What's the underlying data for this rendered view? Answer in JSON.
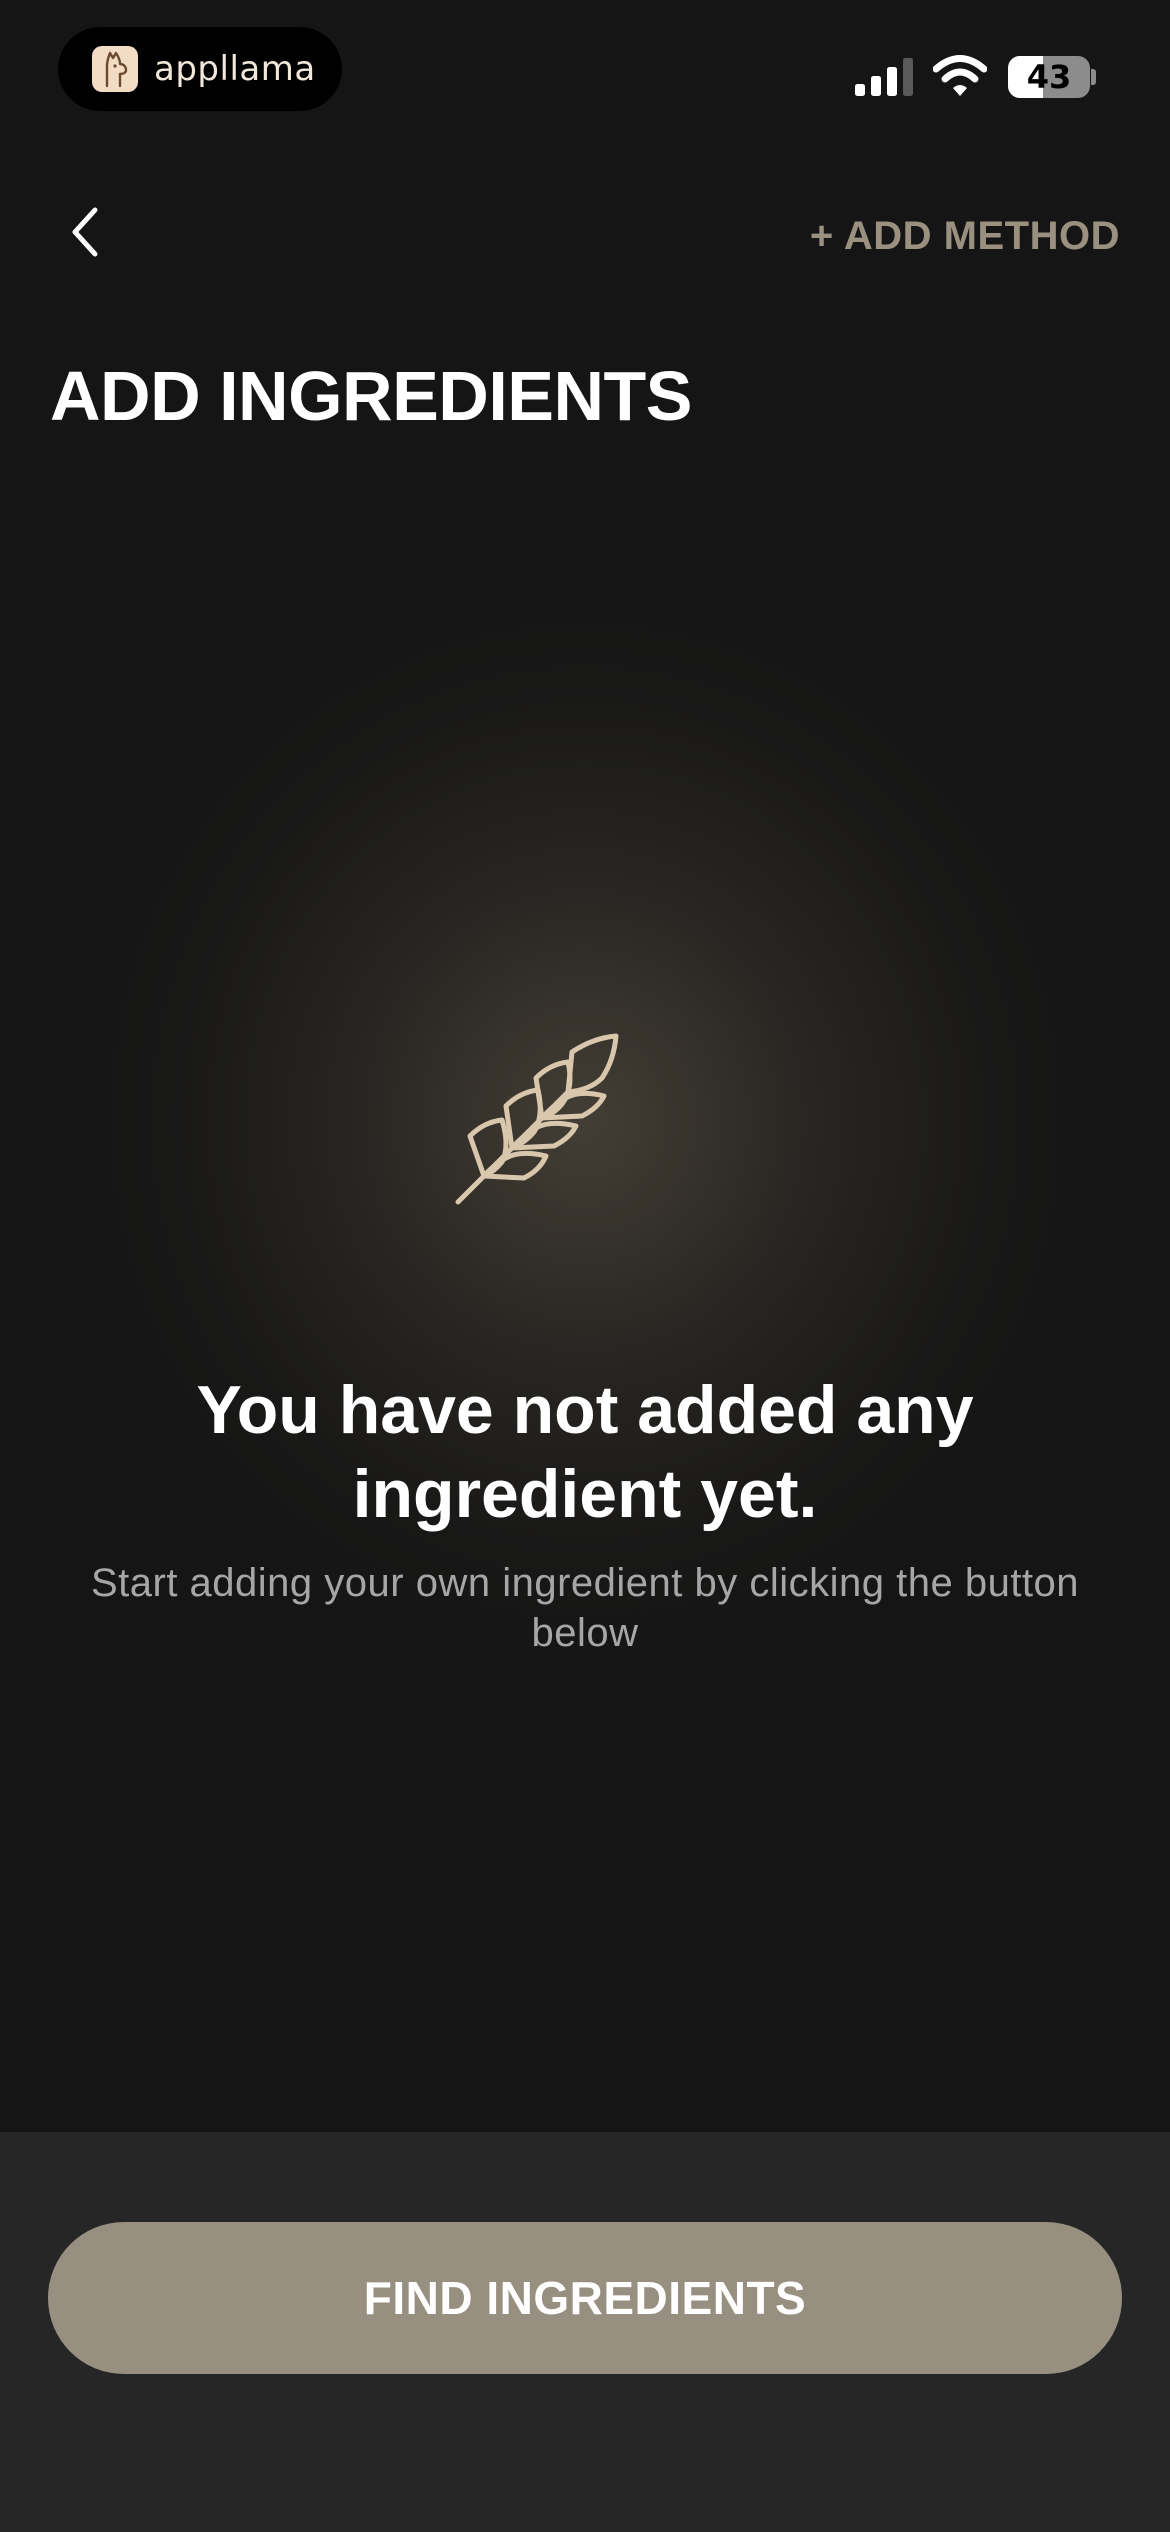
{
  "status_bar": {
    "app_name": "appllama",
    "app_logo_icon": "llama-icon",
    "battery_level": "43",
    "battery_fraction": 0.43,
    "signal_icon": "cellular-signal-icon",
    "wifi_icon": "wifi-icon"
  },
  "nav": {
    "back_icon": "chevron-left-icon",
    "add_method_label": "+ ADD METHOD"
  },
  "page": {
    "title": "ADD INGREDIENTS"
  },
  "empty_state": {
    "icon": "wheat-icon",
    "heading": "You have not added any ingredient yet.",
    "subtext": "Start adding your own ingredient by clicking the button below"
  },
  "footer": {
    "find_button_label": "FIND INGREDIENTS"
  },
  "colors": {
    "background": "#151515",
    "accent": "#979080",
    "accent_text": "#9a9080",
    "icon_stroke": "#d8c7ad",
    "panel": "#262626"
  }
}
